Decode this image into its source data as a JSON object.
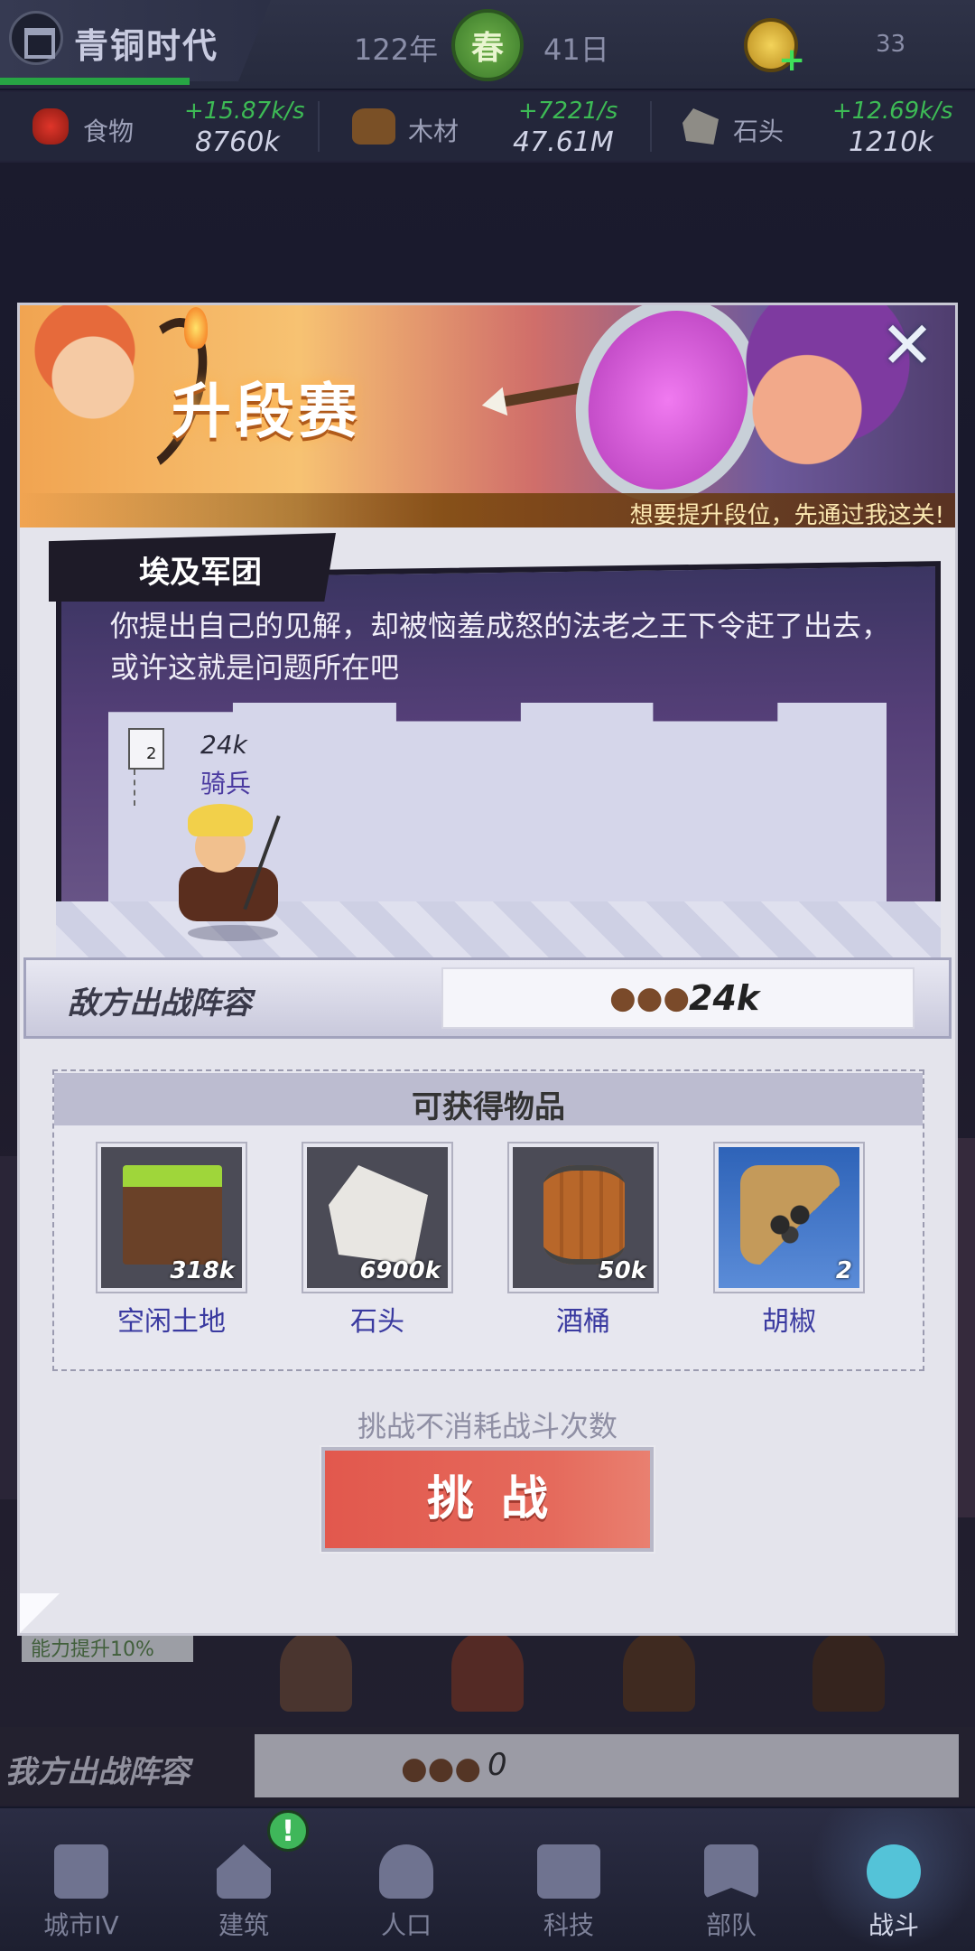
{
  "topbar": {
    "era_title": "青铜时代",
    "year": "122年",
    "season": "春",
    "day": "41日",
    "coins": "33"
  },
  "resources": [
    {
      "icon": "food-icon",
      "name": "食物",
      "rate": "+15.87k/s",
      "total": "8760k"
    },
    {
      "icon": "wood-icon",
      "name": "木材",
      "rate": "+7221/s",
      "total": "47.61M"
    },
    {
      "icon": "stone-icon",
      "name": "石头",
      "rate": "+12.69k/s",
      "total": "1210k"
    }
  ],
  "modal": {
    "banner_title": "升段赛",
    "tagline": "想要提升段位，先通过我这关!",
    "stage_name": "埃及军团",
    "stage_description": "你提出自己的见解，却被恼羞成怒的法老之王下令赶了出去，或许这就是问题所在吧",
    "flag_level": "2",
    "enemy_count": "24k",
    "enemy_type": "骑兵",
    "enemy_lineup_label": "敌方出战阵容",
    "enemy_lineup_total": "24k",
    "rewards_title": "可获得物品",
    "rewards": [
      {
        "name": "空闲土地",
        "qty": "318k",
        "art": "land"
      },
      {
        "name": "石头",
        "qty": "6900k",
        "art": "stone"
      },
      {
        "name": "酒桶",
        "qty": "50k",
        "art": "barrel"
      },
      {
        "name": "胡椒",
        "qty": "2",
        "art": "pepper"
      }
    ],
    "challenge_note": "挑战不消耗战斗次数",
    "challenge_label": "挑战"
  },
  "behind": {
    "power_tag": "能力提升10%",
    "my_lineup_label": "我方出战阵容",
    "my_lineup_total": "0"
  },
  "nav": [
    {
      "label": "城市IV",
      "icon": "castle-icon"
    },
    {
      "label": "建筑",
      "icon": "house-icon"
    },
    {
      "label": "人口",
      "icon": "person-icon"
    },
    {
      "label": "科技",
      "icon": "book-icon"
    },
    {
      "label": "部队",
      "icon": "banner-icon"
    },
    {
      "label": "战斗",
      "icon": "crossed-swords-icon",
      "active": true
    }
  ],
  "nav_alert": "!",
  "colors": {
    "accent_green": "#3dbb55",
    "challenge_red": "#e2584d",
    "reward_name_blue": "#3a3aa0"
  }
}
